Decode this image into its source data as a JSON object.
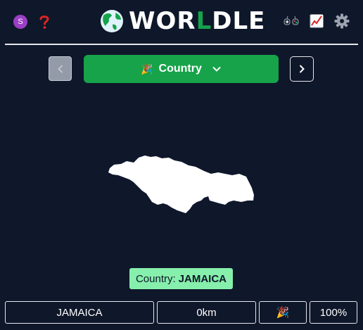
{
  "header": {
    "avatar_letter": "S",
    "help_icon": "question-mark-icon",
    "title_pre": "WOR",
    "title_accent": "L",
    "title_post": "DLE",
    "right_icons": [
      "gamepad-icon",
      "stats-chart-icon",
      "gear-icon"
    ]
  },
  "nav": {
    "mode_label": "Country",
    "mode_icon": "🎉"
  },
  "answer": {
    "prefix": "Country:",
    "value": "JAMAICA"
  },
  "guess": {
    "country": "JAMAICA",
    "distance": "0km",
    "direction_icon": "🎉",
    "proximity": "100%"
  },
  "colors": {
    "background": "#0f172a",
    "accent_green": "#16a34a",
    "answer_bg": "#86efac",
    "avatar": "#9b3fc4",
    "help_red": "#dc2626"
  }
}
